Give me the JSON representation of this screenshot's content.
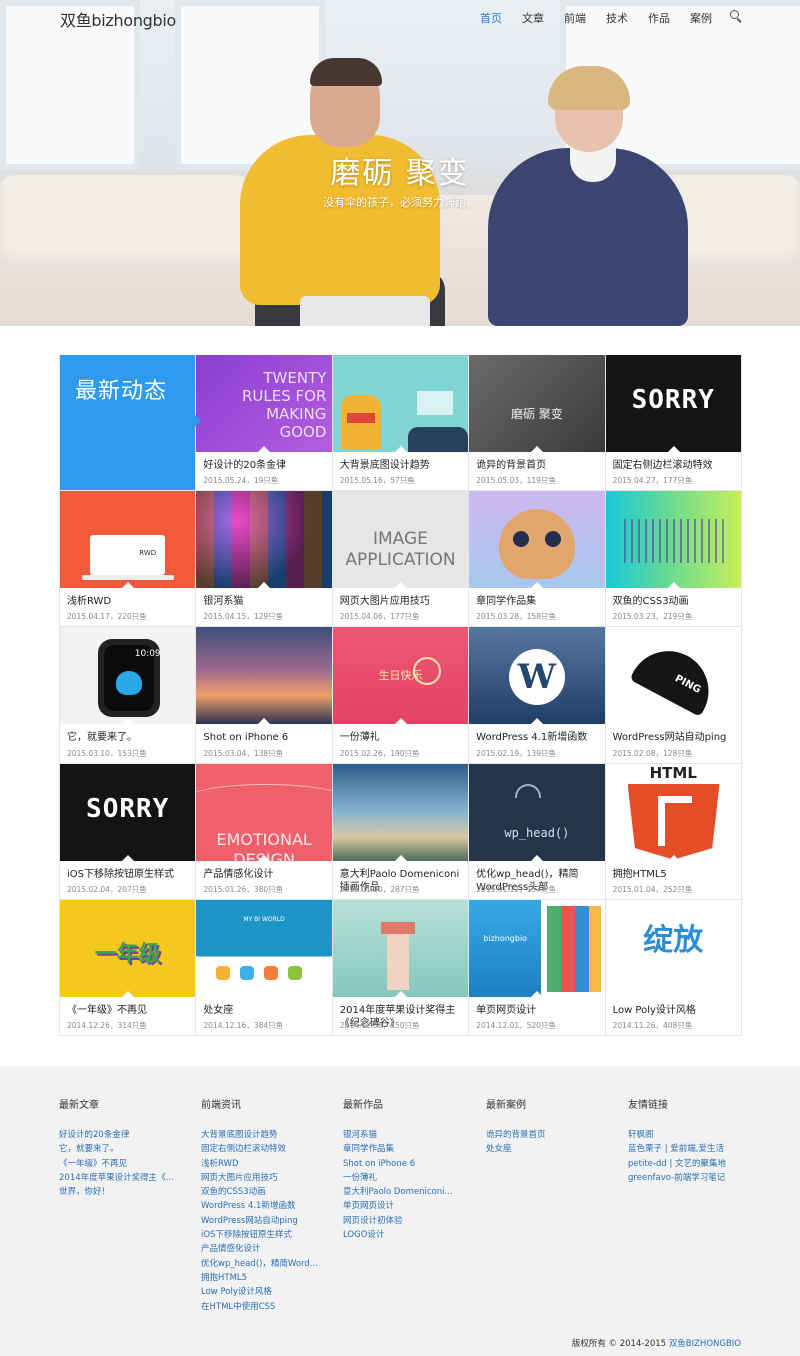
{
  "site": {
    "logo": "双鱼bizhongbio"
  },
  "nav": {
    "items": [
      {
        "label": "首页",
        "active": true
      },
      {
        "label": "文章",
        "active": false
      },
      {
        "label": "前端",
        "active": false
      },
      {
        "label": "技术",
        "active": false
      },
      {
        "label": "作品",
        "active": false
      },
      {
        "label": "案例",
        "active": false
      }
    ],
    "search_icon": "search-icon"
  },
  "hero": {
    "title": "磨砺 聚变",
    "subtitle": "没有伞的孩子，必须努力奔跑。"
  },
  "featured": {
    "label": "最新动态"
  },
  "posts": [
    {
      "title": "好设计的20条金律",
      "meta": "2015.05.24，19只鱼",
      "thumb": "twenty",
      "color": "#9b4fd6",
      "text": "TWENTY RULES FOR MAKING GOOD"
    },
    {
      "title": "大背景底图设计趋势",
      "meta": "2015.05.16，57只鱼",
      "thumb": "teal",
      "color": "#7fd6d2",
      "text": ""
    },
    {
      "title": "诡异的背景首页",
      "meta": "2015.05.03，119只鱼",
      "thumb": "dark",
      "color": "#4a4a4a",
      "text": "磨砺 聚变"
    },
    {
      "title": "固定右侧边栏滚动特效",
      "meta": "2015.04.27，177只鱼",
      "thumb": "sorry",
      "color": "#111111",
      "text": "SORRY"
    },
    {
      "title": "浅析RWD",
      "meta": "2015.04.17，220只鱼",
      "thumb": "rwd",
      "color": "#f25a3c",
      "text": "RWD"
    },
    {
      "title": "银河系猫",
      "meta": "2015.04.15，129只鱼",
      "thumb": "cats",
      "color": "#1a1030",
      "text": ""
    },
    {
      "title": "网页大图片应用技巧",
      "meta": "2015.04.06，177只鱼",
      "thumb": "image",
      "color": "#e4e4e4",
      "text": "IMAGE APPLICATION"
    },
    {
      "title": "章同学作品集",
      "meta": "2015.03.28，158只鱼",
      "thumb": "cat",
      "color": "#c9b6e8",
      "text": ""
    },
    {
      "title": "双鱼的CSS3动画",
      "meta": "2015.03.23，219只鱼",
      "thumb": "wave",
      "color": "#3cc7c7",
      "text": ""
    },
    {
      "title": "它，就要来了。",
      "meta": "2015.03.10，153只鱼",
      "thumb": "watch",
      "color": "#f3f3f3",
      "text": "10:09"
    },
    {
      "title": "Shot on iPhone 6",
      "meta": "2015.03.04，138只鱼",
      "thumb": "sunset",
      "color": "#6a5a8c",
      "text": ""
    },
    {
      "title": "一份薄礼",
      "meta": "2015.02.26，190只鱼",
      "thumb": "gift",
      "color": "#e84c68",
      "text": "生日快乐"
    },
    {
      "title": "WordPress 4.1新增函数",
      "meta": "2015.02.19，139只鱼",
      "thumb": "wp",
      "color": "#2d5a8a",
      "text": "W"
    },
    {
      "title": "WordPress网站自动ping",
      "meta": "2015.02.08，128只鱼",
      "thumb": "umbrella",
      "color": "#ffffff",
      "text": "PING"
    },
    {
      "title": "iOS下移除按钮原生样式",
      "meta": "2015.02.04，207只鱼",
      "thumb": "sorry",
      "color": "#111111",
      "text": "SORRY"
    },
    {
      "title": "产品情感化设计",
      "meta": "2015.01.26，380只鱼",
      "thumb": "emotional",
      "color": "#f0606a",
      "text": "EMOTIONAL DESIGN"
    },
    {
      "title": "意大利Paolo Domeniconi插画作品",
      "meta": "2015.01.20，287只鱼",
      "thumb": "paolo",
      "color": "#5f8fb3",
      "text": ""
    },
    {
      "title": "优化wp_head()，精简WordPress头部",
      "meta": "2015.01.12，157只鱼",
      "thumb": "wphead",
      "color": "#22334a",
      "text": "wp_head()"
    },
    {
      "title": "拥抱HTML5",
      "meta": "2015.01.04，252只鱼",
      "thumb": "html5",
      "color": "#ffffff",
      "text": "HTML"
    },
    {
      "title": "《一年级》不再见",
      "meta": "2014.12.26，314只鱼",
      "thumb": "grade",
      "color": "#f5c81d",
      "text": "一年级"
    },
    {
      "title": "处女座",
      "meta": "2014.12.16，384只鱼",
      "thumb": "virgo",
      "color": "#1f9ac9",
      "text": "MY BI WORLD"
    },
    {
      "title": "2014年度苹果设计奖得主《纪念碑谷》",
      "meta": "2014.12.08，350只鱼",
      "thumb": "monument",
      "color": "#9fd3c9",
      "text": ""
    },
    {
      "title": "单页网页设计",
      "meta": "2014.12.01，520只鱼",
      "thumb": "bizhong",
      "color": "#35a6e0",
      "text": "bizhongbio"
    },
    {
      "title": "Low Poly设计风格",
      "meta": "2014.11.26，408只鱼",
      "thumb": "poly",
      "color": "#ffffff",
      "text": "绽放"
    }
  ],
  "footer": {
    "columns": [
      {
        "heading": "最新文章",
        "links": [
          "好设计的20条金律",
          "它，就要来了。",
          "《一年级》不再见",
          "2014年度苹果设计奖得主《...",
          "世界，你好！"
        ]
      },
      {
        "heading": "前端资讯",
        "links": [
          "大背景底图设计趋势",
          "固定右侧边栏滚动特效",
          "浅析RWD",
          "网页大图片应用技巧",
          "双鱼的CSS3动画",
          "WordPress 4.1新增函数",
          "WordPress网站自动ping",
          "iOS下移除按钮原生样式",
          "产品情感化设计",
          "优化wp_head()，精简Word...",
          "拥抱HTML5",
          "Low Poly设计风格",
          "在HTML中使用CSS"
        ]
      },
      {
        "heading": "最新作品",
        "links": [
          "银河系猫",
          "章同学作品集",
          "Shot on iPhone 6",
          "一份薄礼",
          "意大利Paolo Domeniconi...",
          "单页网页设计",
          "网页设计初体验",
          "LOGO设计"
        ]
      },
      {
        "heading": "最新案例",
        "links": [
          "诡异的背景首页",
          "处女座"
        ]
      },
      {
        "heading": "友情链接",
        "links": [
          "轩枫阁",
          "蓝色栗子 | 爱前端,爱生活",
          "petite-dd | 文艺的聚集地",
          "greenfavo-前端学习笔记"
        ]
      }
    ],
    "copyright_prefix": "版权所有 © 2014-2015",
    "copyright_link": "双鱼BIZHONGBIO"
  }
}
